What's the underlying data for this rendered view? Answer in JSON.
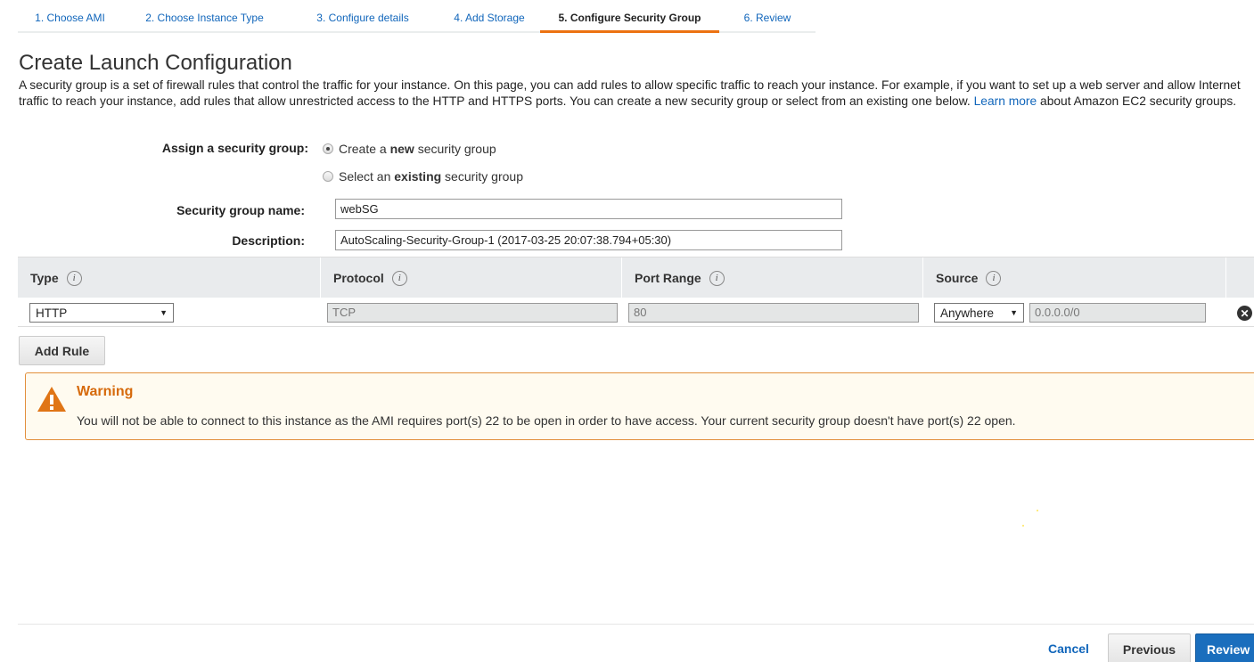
{
  "wizard": {
    "steps": [
      {
        "label": "1. Choose AMI"
      },
      {
        "label": "2. Choose Instance Type"
      },
      {
        "label": "3. Configure details"
      },
      {
        "label": "4. Add Storage"
      },
      {
        "label": "5. Configure Security Group"
      },
      {
        "label": "6. Review"
      }
    ],
    "active_step": "5. Configure Security Group"
  },
  "page": {
    "title": "Create Launch Configuration",
    "intro_1": "A security group is a set of firewall rules that control the traffic for your instance. On this page, you can add rules to allow specific traffic to reach your instance. For example, if you want to set up a web server and allow Internet traffic to reach your instance, add rules that allow unrestricted access to the HTTP and HTTPS ports. You can create a new security group or select from an existing one below.",
    "learn_more": "Learn more",
    "intro_2": "about Amazon EC2 security groups."
  },
  "form": {
    "assign_label": "Assign a security group:",
    "option_new_pre": "Create a ",
    "option_new_bold": "new",
    "option_new_post": " security group",
    "option_existing_pre": "Select an ",
    "option_existing_bold": "existing",
    "option_existing_post": " security group",
    "selected_option": "new",
    "name_label": "Security group name:",
    "name_value": "webSG",
    "description_label": "Description:",
    "description_value": "AutoScaling-Security-Group-1 (2017-03-25 20:07:38.794+05:30)"
  },
  "rules_table": {
    "columns": [
      "Type",
      "Protocol",
      "Port Range",
      "Source"
    ],
    "info_icon": "i",
    "rows": [
      {
        "type": "HTTP",
        "protocol": "TCP",
        "port_range": "80",
        "source_type": "Anywhere",
        "source_cidr": "0.0.0.0/0"
      }
    ],
    "add_rule_label": "Add Rule"
  },
  "warning": {
    "title": "Warning",
    "message": "You will not be able to connect to this instance as the AMI requires port(s) 22 to be open in order to have access. Your current security group doesn't have port(s) 22 open."
  },
  "footer": {
    "cancel_label": "Cancel",
    "previous_label": "Previous",
    "review_label": "Review"
  },
  "colors": {
    "link": "#1166bb",
    "active_step_underline": "#ec7211",
    "warning_border": "#e28f3b",
    "warning_title": "#d66a0c",
    "primary_button": "#1a6ebd"
  }
}
